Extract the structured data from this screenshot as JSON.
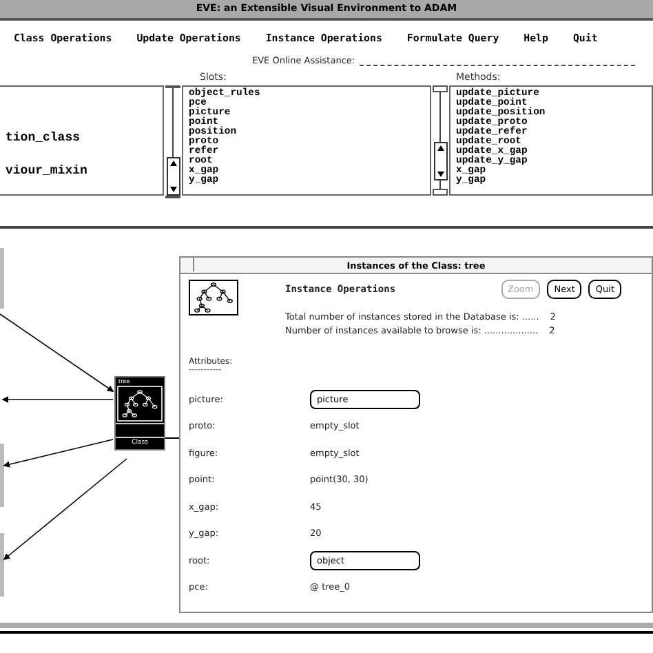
{
  "window": {
    "title": "EVE: an Extensible Visual Environment to ADAM"
  },
  "menu": [
    "Class Operations",
    "Update Operations",
    "Instance Operations",
    "Formulate Query",
    "Help",
    "Quit"
  ],
  "assistance": {
    "label": "EVE Online Assistance:"
  },
  "classes_list": {
    "items": [
      "tion_class",
      "viour_mixin"
    ]
  },
  "slots": {
    "label": "Slots:",
    "items": [
      "object_rules",
      "pce",
      "picture",
      "point",
      "position",
      "proto",
      "refer",
      "root",
      "x_gap",
      "y_gap"
    ]
  },
  "methods": {
    "label": "Methods:",
    "items": [
      "update_picture",
      "update_point",
      "update_position",
      "update_proto",
      "update_refer",
      "update_root",
      "update_x_gap",
      "update_y_gap",
      "x_gap",
      "y_gap"
    ]
  },
  "diagram": {
    "node": {
      "title": "tree",
      "label": "Class"
    }
  },
  "instance_window": {
    "title": "Instances of the Class: tree",
    "heading": "Instance Operations",
    "buttons": [
      {
        "label": "Zoom",
        "disabled": true
      },
      {
        "label": "Next",
        "disabled": false
      },
      {
        "label": "Quit",
        "disabled": false
      }
    ],
    "stats": [
      {
        "text": "Total number of instances stored in the Database is: ......",
        "value": "2"
      },
      {
        "text": "Number of instances available to browse is: ...................",
        "value": "2"
      }
    ],
    "attributes_label": "Attributes:",
    "attributes_rule": "-----------",
    "attributes": [
      {
        "name": "picture:",
        "value": "picture",
        "kind": "button"
      },
      {
        "name": "proto:",
        "value": "empty_slot",
        "kind": "text"
      },
      {
        "name": "figure:",
        "value": "empty_slot",
        "kind": "text"
      },
      {
        "name": "point:",
        "value": "point(30, 30)",
        "kind": "text"
      },
      {
        "name": "x_gap:",
        "value": "45",
        "kind": "text"
      },
      {
        "name": "y_gap:",
        "value": "20",
        "kind": "text"
      },
      {
        "name": "root:",
        "value": "object",
        "kind": "button"
      },
      {
        "name": "pce:",
        "value": "@ tree_0",
        "kind": "text"
      }
    ]
  }
}
